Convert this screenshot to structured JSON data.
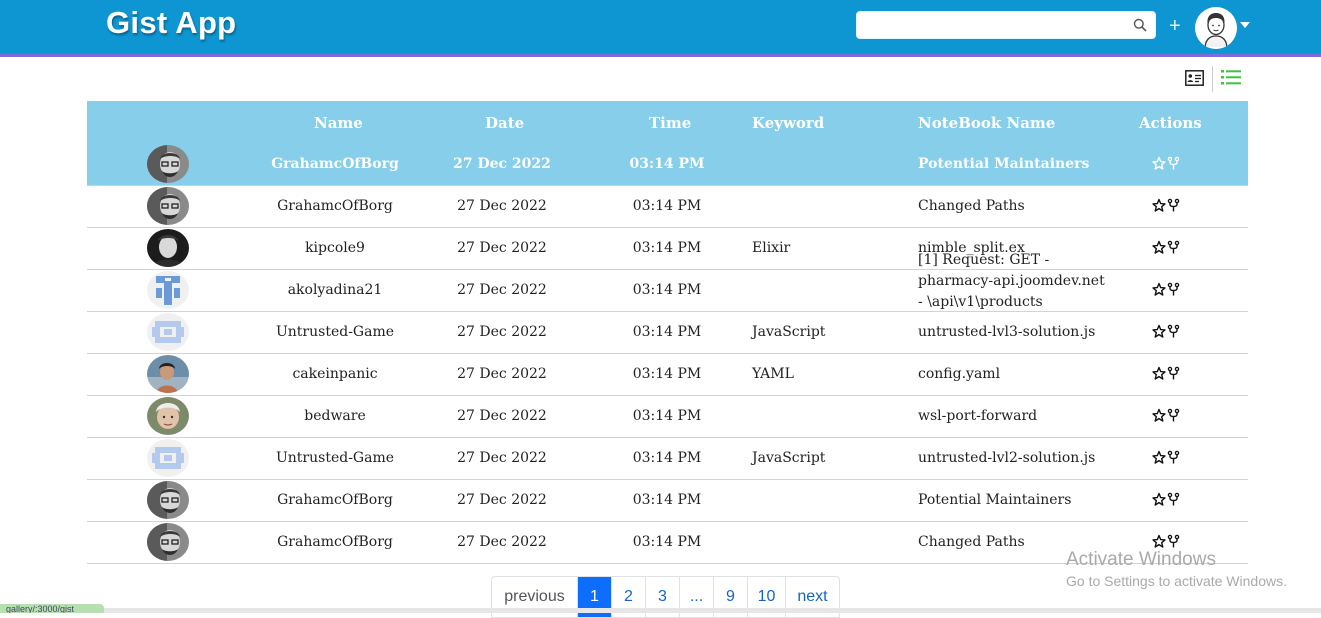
{
  "header": {
    "app_title": "Gist App",
    "search": {
      "value": "",
      "placeholder": ""
    },
    "plus_label": "+",
    "icons": [
      "search-icon",
      "plus-icon",
      "user-avatar",
      "caret-down-icon"
    ]
  },
  "view_toggle": {
    "icons": [
      "card-view-icon",
      "list-view-icon"
    ],
    "active": "list"
  },
  "colors": {
    "header_bg": "#0d96d2",
    "header_border": "#7c6bd9",
    "table_header_bg": "#87ceeb",
    "selected_row_bg": "#87ceeb",
    "list_icon": "#3cc43c",
    "pagination_active": "#0d6efd"
  },
  "table": {
    "columns": [
      "Name",
      "Date",
      "Time",
      "Keyword",
      "NoteBook Name",
      "Actions"
    ],
    "rows": [
      {
        "name": "GrahamcOfBorg",
        "date": "27 Dec 2022",
        "time": "03:14 PM",
        "keyword": "",
        "notebook": "Potential Maintainers",
        "avatar": "photo-gray",
        "selected": true
      },
      {
        "name": "GrahamcOfBorg",
        "date": "27 Dec 2022",
        "time": "03:14 PM",
        "keyword": "",
        "notebook": "Changed Paths",
        "avatar": "photo-gray"
      },
      {
        "name": "kipcole9",
        "date": "27 Dec 2022",
        "time": "03:14 PM",
        "keyword": "Elixir",
        "notebook": "nimble_split.ex",
        "avatar": "photo-dark"
      },
      {
        "name": "akolyadina21",
        "date": "27 Dec 2022",
        "time": "03:14 PM",
        "keyword": "",
        "notebook_lines": [
          "[1] Request: GET -",
          "pharmacy-api.joomdev.net",
          "- \\api\\v1\\products"
        ],
        "avatar": "identicon-blue"
      },
      {
        "name": "Untrusted-Game",
        "date": "27 Dec 2022",
        "time": "03:14 PM",
        "keyword": "JavaScript",
        "notebook": "untrusted-lvl3-solution.js",
        "avatar": "identicon-lightblue"
      },
      {
        "name": "cakeinpanic",
        "date": "27 Dec 2022",
        "time": "03:14 PM",
        "keyword": "YAML",
        "notebook": "config.yaml",
        "avatar": "photo-sea"
      },
      {
        "name": "bedware",
        "date": "27 Dec 2022",
        "time": "03:14 PM",
        "keyword": "",
        "notebook": "wsl-port-forward",
        "avatar": "photo-face"
      },
      {
        "name": "Untrusted-Game",
        "date": "27 Dec 2022",
        "time": "03:14 PM",
        "keyword": "JavaScript",
        "notebook": "untrusted-lvl2-solution.js",
        "avatar": "identicon-lightblue"
      },
      {
        "name": "GrahamcOfBorg",
        "date": "27 Dec 2022",
        "time": "03:14 PM",
        "keyword": "",
        "notebook": "Potential Maintainers",
        "avatar": "photo-gray"
      },
      {
        "name": "GrahamcOfBorg",
        "date": "27 Dec 2022",
        "time": "03:14 PM",
        "keyword": "",
        "notebook": "Changed Paths",
        "avatar": "photo-gray"
      }
    ],
    "action_icons": [
      "star-icon",
      "fork-icon"
    ]
  },
  "pagination": {
    "previous": "previous",
    "pages": [
      "1",
      "2",
      "3",
      "...",
      "9",
      "10"
    ],
    "active": "1",
    "next": "next"
  },
  "watermark": {
    "line1": "Activate Windows",
    "line2": "Go to Settings to activate Windows."
  },
  "status_url": "gallery/:3000/gist"
}
